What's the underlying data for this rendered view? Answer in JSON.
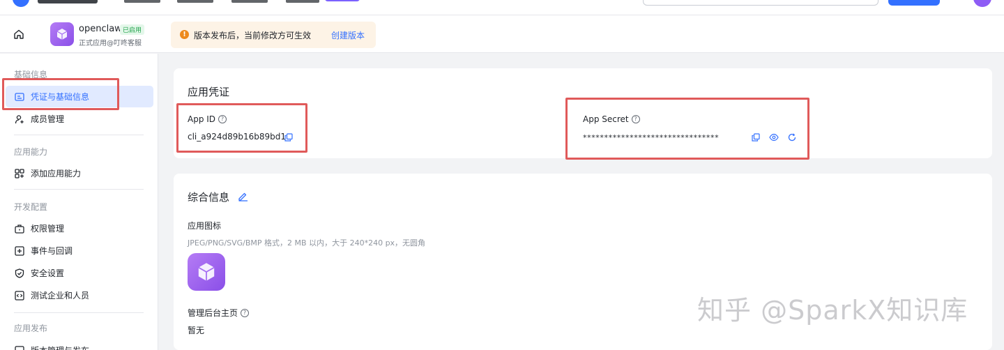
{
  "subheader": {
    "app_name": "openclaw",
    "app_status": "已启用",
    "app_subtitle": "正式应用@叮咚客服",
    "notice_text": "版本发布后，当前修改方可生效",
    "notice_link": "创建版本"
  },
  "sidebar": {
    "groups": [
      {
        "title": "基础信息",
        "items": [
          "凭证与基础信息",
          "成员管理"
        ]
      },
      {
        "title": "应用能力",
        "items": [
          "添加应用能力"
        ]
      },
      {
        "title": "开发配置",
        "items": [
          "权限管理",
          "事件与回调",
          "安全设置",
          "测试企业和人员"
        ]
      },
      {
        "title": "应用发布",
        "items": [
          "版本管理与发布"
        ]
      }
    ]
  },
  "credentials": {
    "title": "应用凭证",
    "app_id_label": "App ID",
    "app_id_value": "cli_a924d89b16b89bd1",
    "app_secret_label": "App Secret",
    "app_secret_value": "********************************"
  },
  "general": {
    "title": "综合信息",
    "icon_label": "应用图标",
    "icon_hint": "JPEG/PNG/SVG/BMP 格式，2 MB 以内，大于 240*240 px，无圆角",
    "homepage_label": "管理后台主页",
    "homepage_value": "暂无"
  },
  "watermark": "知乎 @SparkX知识库",
  "colors": {
    "accent": "#3370ff",
    "active_bg": "#e1eaff",
    "highlight": "#e05a5a",
    "app_icon": "#9a5ff0"
  }
}
